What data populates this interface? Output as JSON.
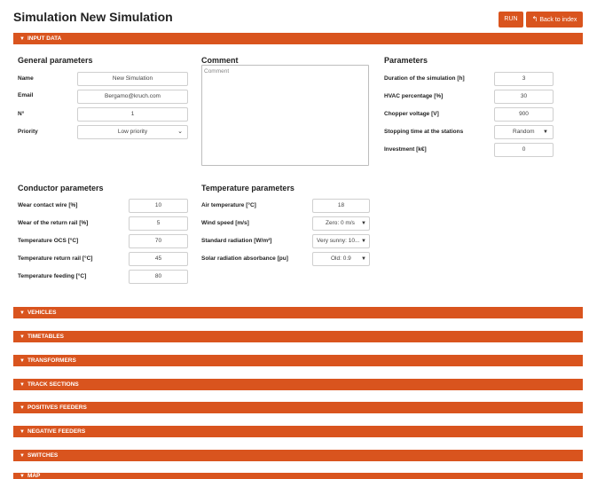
{
  "header": {
    "title": "Simulation New Simulation",
    "run_label": "RUN",
    "back_label": "Back to index"
  },
  "input_data": {
    "label": "INPUT DATA"
  },
  "general": {
    "title": "General parameters",
    "name_label": "Name",
    "name_value": "New Simulation",
    "email_label": "Email",
    "email_value": "Bergamo@kruch.com",
    "number_label": "N°",
    "number_value": "1",
    "priority_label": "Priority",
    "priority_value": "Low priority"
  },
  "comment": {
    "title": "Comment",
    "placeholder": "Comment"
  },
  "parameters": {
    "title": "Parameters",
    "duration_label": "Duration of the simulation [h]",
    "duration_value": "3",
    "hvac_label": "HVAC percentage [%]",
    "hvac_value": "30",
    "chopper_label": "Chopper voltage [V]",
    "chopper_value": "900",
    "stopping_label": "Stopping time at the stations",
    "stopping_value": "Random",
    "investment_label": "Investment [k€]",
    "investment_value": "0"
  },
  "conductor": {
    "title": "Conductor parameters",
    "wear_contact_label": "Wear contact wire [%]",
    "wear_contact_value": "10",
    "wear_return_label": "Wear of the return rail [%]",
    "wear_return_value": "5",
    "temp_ocs_label": "Temperature OCS [°C]",
    "temp_ocs_value": "70",
    "temp_return_label": "Temperature return rail [°C]",
    "temp_return_value": "45",
    "temp_feeding_label": "Temperature feeding [°C]",
    "temp_feeding_value": "80"
  },
  "temperature": {
    "title": "Temperature parameters",
    "air_label": "Air temperature [°C]",
    "air_value": "18",
    "wind_label": "Wind speed [m/s]",
    "wind_value": "Zero: 0 m/s",
    "radiation_label": "Standard radiation [W/m²]",
    "radiation_value": "Very sunny: 10...",
    "absorbance_label": "Solar radiation absorbance [pu]",
    "absorbance_value": "Old: 0.9"
  },
  "sections": [
    "VEHICLES",
    "TIMETABLES",
    "TRANSFORMERS",
    "TRACK SECTIONS",
    "POSITIVES FEEDERS",
    "NEGATIVE FEEDERS",
    "SWITCHES",
    "MAP"
  ],
  "colors": {
    "accent": "#d9541e"
  }
}
